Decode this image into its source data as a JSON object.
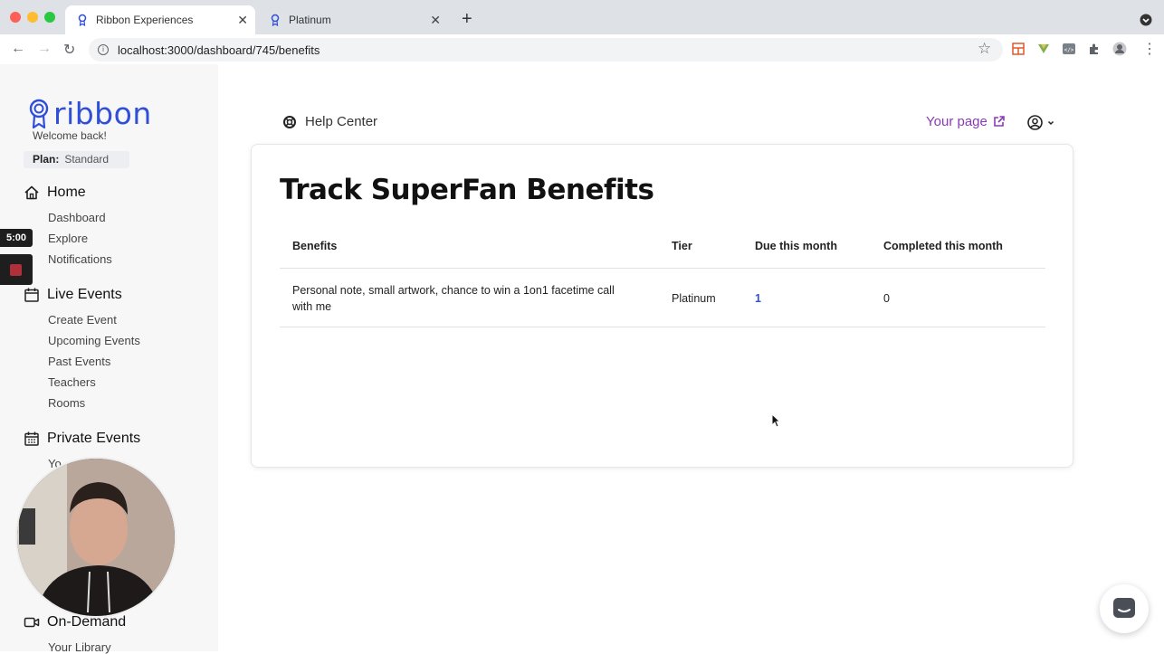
{
  "browser": {
    "tabs": [
      {
        "title": "Ribbon Experiences",
        "active": true
      },
      {
        "title": "Platinum",
        "active": false
      }
    ],
    "new_tab": "+",
    "url": "localhost:3000/dashboard/745/benefits"
  },
  "sidebar": {
    "logo_text": "ribbon",
    "welcome": "Welcome back!",
    "plan_label": "Plan:",
    "plan_value": "Standard",
    "sections": [
      {
        "title": "Home",
        "icon": "home-icon",
        "items": [
          "Dashboard",
          "Explore",
          "Notifications"
        ]
      },
      {
        "title": "Live Events",
        "icon": "calendar-icon",
        "items": [
          "Create Event",
          "Upcoming Events",
          "Past Events",
          "Teachers",
          "Rooms"
        ]
      },
      {
        "title": "Private Events",
        "icon": "calendar-grid-icon",
        "items": [
          "Yo"
        ]
      },
      {
        "title": "On-Demand",
        "icon": "video-icon",
        "items": [
          "Your Library"
        ]
      }
    ]
  },
  "recorder": {
    "timer": "5:00"
  },
  "header": {
    "help_center": "Help Center",
    "your_page": "Your page"
  },
  "page": {
    "title": "Track SuperFan Benefits",
    "table": {
      "headers": [
        "Benefits",
        "Tier",
        "Due this month",
        "Completed this month"
      ],
      "rows": [
        {
          "benefit": "Personal note, small artwork, chance to win a 1on1 facetime call with me",
          "tier": "Platinum",
          "due": "1",
          "completed": "0"
        }
      ]
    }
  },
  "colors": {
    "brand": "#2f4fd8",
    "your_page_link": "#8a3ab9"
  }
}
